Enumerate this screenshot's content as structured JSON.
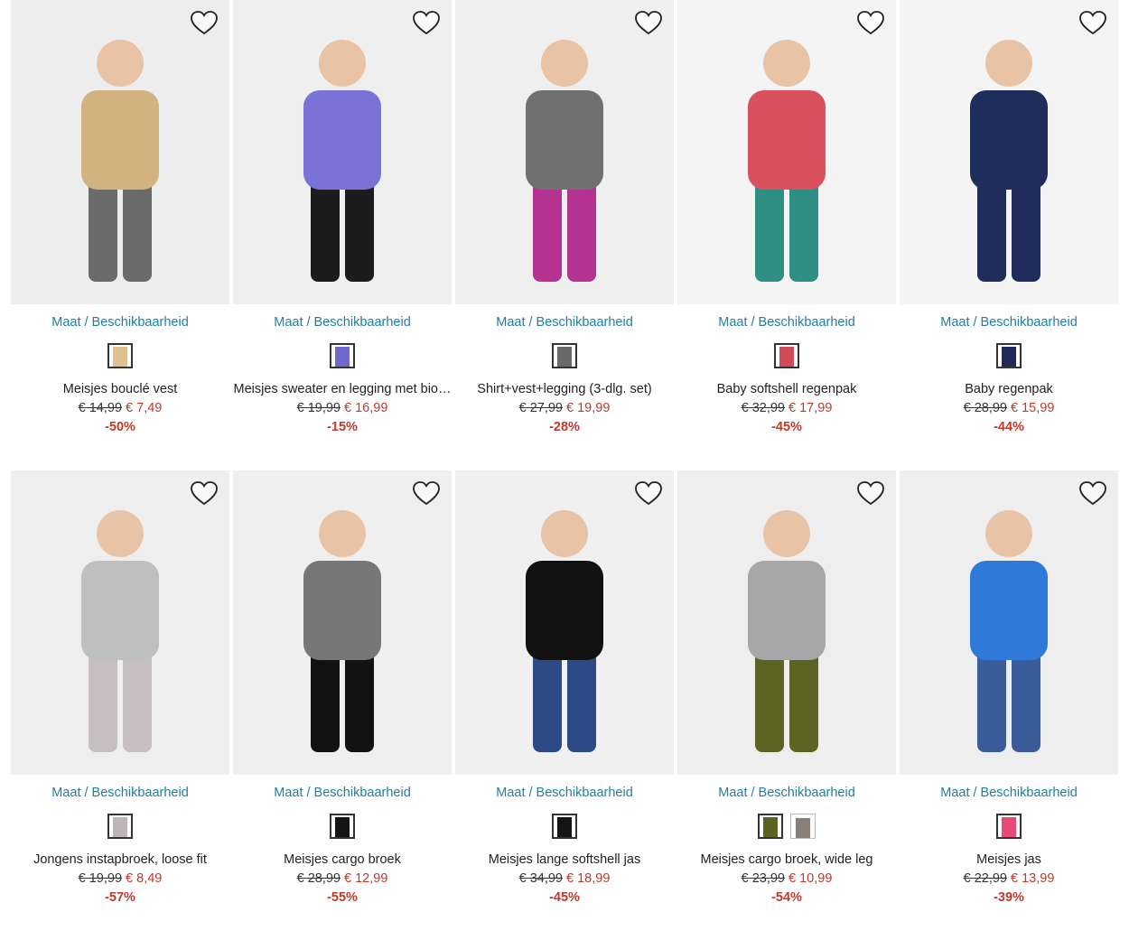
{
  "avail_label": "Maat / Beschikbaarheid",
  "products": [
    {
      "name": "Meisjes bouclé vest",
      "old_price": "€ 14,99",
      "new_price": "€ 7,49",
      "discount": "-50%",
      "bg": "#ededed",
      "top": "#d2b380",
      "bottom": "#6b6b6b",
      "swatches": [
        "#e0c08e"
      ]
    },
    {
      "name": "Meisjes sweater en legging met bio…",
      "old_price": "€ 19,99",
      "new_price": "€ 16,99",
      "discount": "-15%",
      "bg": "#efefef",
      "top": "#7b72d8",
      "bottom": "#1c1c1c",
      "swatches": [
        "#6f68cf"
      ]
    },
    {
      "name": "Shirt+vest+legging (3-dlg. set)",
      "old_price": "€ 27,99",
      "new_price": "€ 19,99",
      "discount": "-28%",
      "bg": "#efefef",
      "top": "#707070",
      "bottom": "#b43390",
      "swatches": [
        "#6a6a6a"
      ]
    },
    {
      "name": "Baby softshell regenpak",
      "old_price": "€ 32,99",
      "new_price": "€ 17,99",
      "discount": "-45%",
      "bg": "#f4f4f4",
      "top": "#d9505e",
      "bottom": "#2f8f82",
      "swatches": [
        "#d24a58"
      ]
    },
    {
      "name": "Baby regenpak",
      "old_price": "€ 28,99",
      "new_price": "€ 15,99",
      "discount": "-44%",
      "bg": "#f4f4f4",
      "top": "#1f2d5c",
      "bottom": "#1f2d5c",
      "swatches": [
        "#1e2a55"
      ]
    },
    {
      "name": "Jongens instapbroek, loose fit",
      "old_price": "€ 19,99",
      "new_price": "€ 8,49",
      "discount": "-57%",
      "bg": "#eeeeee",
      "top": "#bfbfbf",
      "bottom": "#c6bfc2",
      "swatches": [
        "#bdb6b8"
      ]
    },
    {
      "name": "Meisjes cargo broek",
      "old_price": "€ 28,99",
      "new_price": "€ 12,99",
      "discount": "-55%",
      "bg": "#efefef",
      "top": "#777777",
      "bottom": "#121212",
      "swatches": [
        "#151515"
      ]
    },
    {
      "name": "Meisjes lange softshell jas",
      "old_price": "€ 34,99",
      "new_price": "€ 18,99",
      "discount": "-45%",
      "bg": "#f0f0f0",
      "top": "#111111",
      "bottom": "#2c4a86",
      "swatches": [
        "#141414"
      ]
    },
    {
      "name": "Meisjes cargo broek, wide leg",
      "old_price": "€ 23,99",
      "new_price": "€ 10,99",
      "discount": "-54%",
      "bg": "#eeeeee",
      "top": "#a7a7a7",
      "bottom": "#5d6423",
      "swatches": [
        "#5b6222",
        "#8a7e78"
      ]
    },
    {
      "name": "Meisjes jas",
      "old_price": "€ 22,99",
      "new_price": "€ 13,99",
      "discount": "-39%",
      "bg": "#eeeeee",
      "top": "#2f7ad9",
      "bottom": "#3a5d9a",
      "swatches": [
        "#e84a74"
      ]
    }
  ]
}
